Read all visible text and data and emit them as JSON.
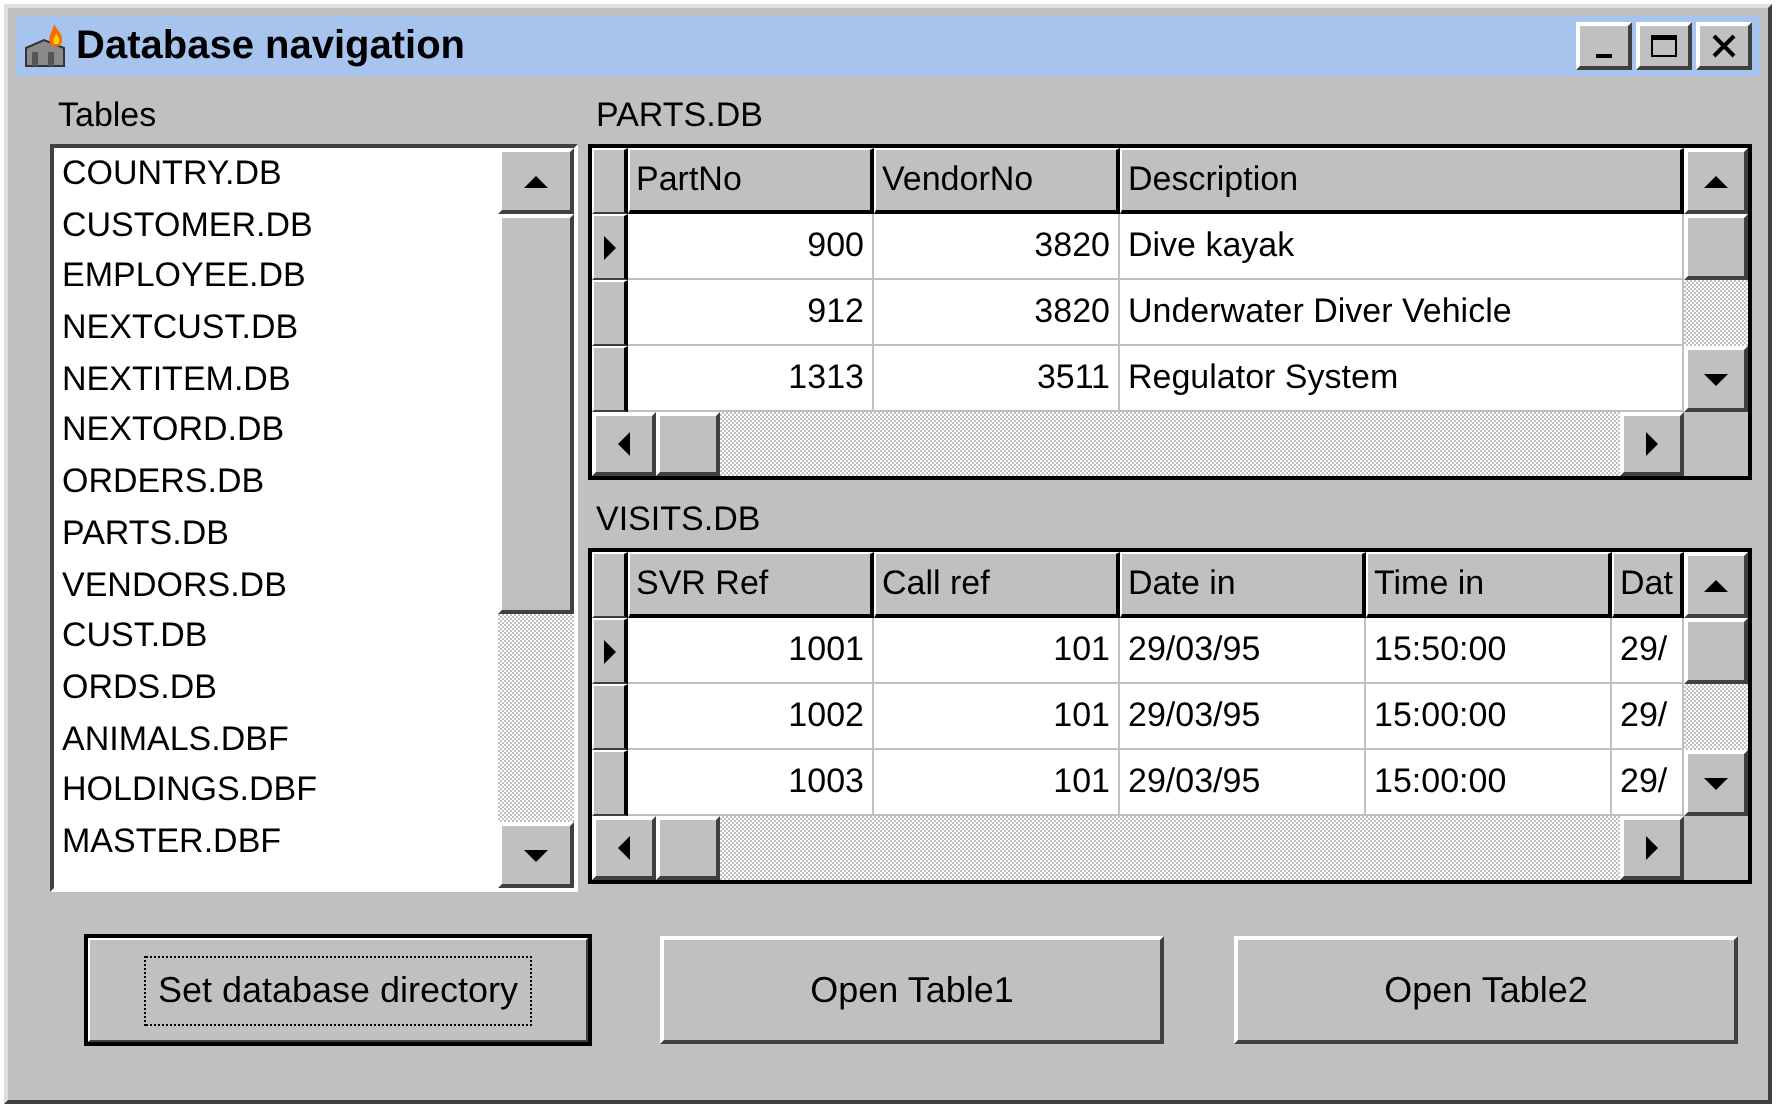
{
  "window": {
    "title": "Database navigation"
  },
  "tables_list": {
    "label": "Tables",
    "items": [
      {
        "name": "COUNTRY.DB",
        "selected": false
      },
      {
        "name": "CUSTOMER.DB",
        "selected": false
      },
      {
        "name": "EMPLOYEE.DB",
        "selected": false
      },
      {
        "name": "NEXTCUST.DB",
        "selected": false
      },
      {
        "name": "NEXTITEM.DB",
        "selected": false
      },
      {
        "name": "NEXTORD.DB",
        "selected": false
      },
      {
        "name": "ORDERS.DB",
        "selected": false
      },
      {
        "name": "PARTS.DB",
        "selected": false
      },
      {
        "name": "VENDORS.DB",
        "selected": false
      },
      {
        "name": "CUST.DB",
        "selected": false
      },
      {
        "name": "ORDS.DB",
        "selected": false
      },
      {
        "name": "ANIMALS.DBF",
        "selected": false
      },
      {
        "name": "HOLDINGS.DBF",
        "selected": false
      },
      {
        "name": "MASTER.DBF",
        "selected": false
      }
    ]
  },
  "grids": [
    {
      "label": "PARTS.DB",
      "columns": [
        {
          "title": "PartNo",
          "kind": "number"
        },
        {
          "title": "VendorNo",
          "kind": "number"
        },
        {
          "title": "Description",
          "kind": "text"
        }
      ],
      "rows": [
        {
          "selected": true,
          "cells": [
            "900",
            "3820",
            "Dive kayak"
          ]
        },
        {
          "selected": false,
          "cells": [
            "912",
            "3820",
            "Underwater Diver Vehicle"
          ]
        },
        {
          "selected": false,
          "cells": [
            "1313",
            "3511",
            "Regulator System"
          ]
        }
      ]
    },
    {
      "label": "VISITS.DB",
      "columns": [
        {
          "title": "SVR Ref",
          "kind": "number"
        },
        {
          "title": "Call ref",
          "kind": "number"
        },
        {
          "title": "Date in",
          "kind": "text"
        },
        {
          "title": "Time in",
          "kind": "text"
        },
        {
          "title": "Dat",
          "kind": "text"
        }
      ],
      "rows": [
        {
          "selected": true,
          "cells": [
            "1001",
            "101",
            "29/03/95",
            "15:50:00",
            "29/"
          ]
        },
        {
          "selected": false,
          "cells": [
            "1002",
            "101",
            "29/03/95",
            "15:00:00",
            "29/"
          ]
        },
        {
          "selected": false,
          "cells": [
            "1003",
            "101",
            "29/03/95",
            "15:00:00",
            "29/"
          ]
        }
      ]
    }
  ],
  "buttons": [
    {
      "label": "Set database directory",
      "default": true
    },
    {
      "label": "Open Table1",
      "default": false
    },
    {
      "label": "Open Table2",
      "default": false
    }
  ]
}
